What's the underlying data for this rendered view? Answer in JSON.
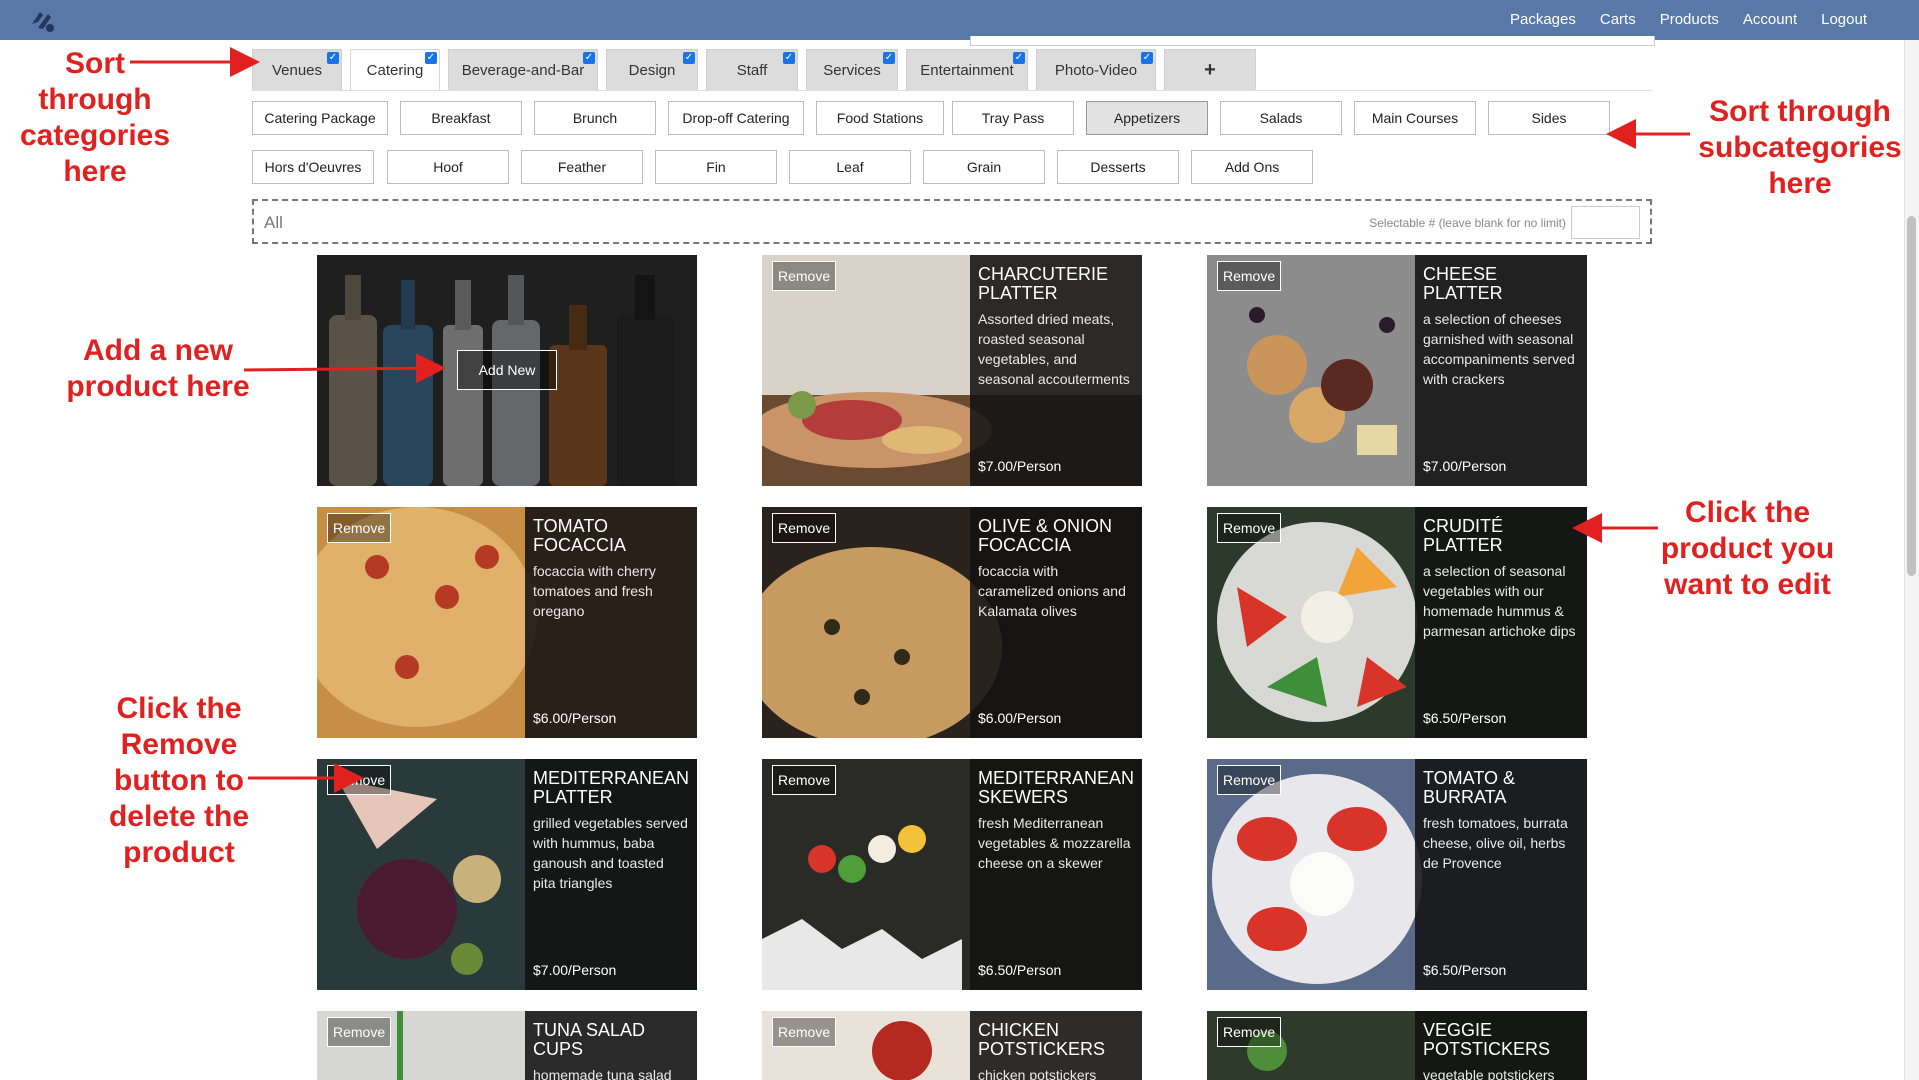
{
  "topnav": [
    "Packages",
    "Carts",
    "Products",
    "Account",
    "Logout"
  ],
  "tabs": [
    {
      "label": "Venues",
      "active": false
    },
    {
      "label": "Catering",
      "active": true
    },
    {
      "label": "Beverage-and-Bar",
      "active": false
    },
    {
      "label": "Design",
      "active": false
    },
    {
      "label": "Staff",
      "active": false
    },
    {
      "label": "Services",
      "active": false
    },
    {
      "label": "Entertainment",
      "active": false
    },
    {
      "label": "Photo-Video",
      "active": false
    }
  ],
  "add_tab_label": "+",
  "subcategories_row1": [
    "Catering Package",
    "Breakfast",
    "Brunch",
    "Drop-off Catering",
    "Food Stations",
    "Tray Pass",
    "Appetizers",
    "Salads",
    "Main Courses",
    "Sides"
  ],
  "subcategories_row2": [
    "Hors d'Oeuvres",
    "Hoof",
    "Feather",
    "Fin",
    "Leaf",
    "Grain",
    "Desserts",
    "Add Ons"
  ],
  "active_subcategory": "Appetizers",
  "selection": {
    "all_label": "All",
    "hint": "Selectable # (leave blank for no limit)",
    "value": ""
  },
  "add_new_label": "Add New",
  "remove_label": "Remove",
  "products": [
    {
      "name": "CHARCUTERIE PLATTER",
      "desc": "Assorted dried meats, roasted seasonal vegetables, and seasonal accouterments",
      "price": "$7.00/Person"
    },
    {
      "name": "CHEESE PLATTER",
      "desc": "a selection of cheeses garnished with seasonal accompaniments served with crackers",
      "price": "$7.00/Person"
    },
    {
      "name": "TOMATO FOCACCIA",
      "desc": "focaccia with cherry tomatoes and fresh oregano",
      "price": "$6.00/Person"
    },
    {
      "name": "OLIVE & ONION FOCACCIA",
      "desc": "focaccia with caramelized onions and Kalamata olives",
      "price": "$6.00/Person"
    },
    {
      "name": "CRUDITÉ PLATTER",
      "desc": "a selection of seasonal vegetables with our homemade hummus & parmesan artichoke dips",
      "price": "$6.50/Person"
    },
    {
      "name": "MEDITERRANEAN PLATTER",
      "desc": "grilled vegetables served with hummus, baba ganoush and toasted pita triangles",
      "price": "$7.00/Person"
    },
    {
      "name": "MEDITERRANEAN SKEWERS",
      "desc": "fresh Mediterranean vegetables & mozzarella cheese on a skewer",
      "price": "$6.50/Person"
    },
    {
      "name": "TOMATO & BURRATA",
      "desc": "fresh tomatoes, burrata cheese, olive oil, herbs de Provence",
      "price": "$6.50/Person"
    },
    {
      "name": "TUNA SALAD CUPS",
      "desc": "homemade tuna salad",
      "price": ""
    },
    {
      "name": "CHICKEN POTSTICKERS",
      "desc": "chicken potstickers",
      "price": ""
    },
    {
      "name": "VEGGIE POTSTICKERS",
      "desc": "vegetable potstickers",
      "price": ""
    }
  ],
  "annotations": {
    "categories": "Sort through categories here",
    "subcategories": "Sort through subcategories here",
    "add_new": "Add a new product here",
    "edit": "Click the product you want to edit",
    "remove": "Click the Remove button to delete the product"
  },
  "colors": {
    "topbar": "#5878a8",
    "annotation": "#e0211f",
    "checkbox": "#1a73e8"
  }
}
